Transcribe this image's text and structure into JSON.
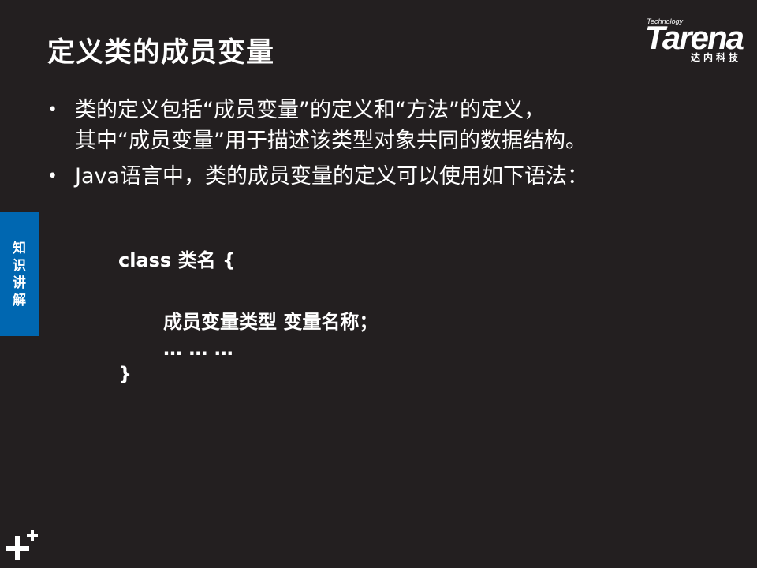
{
  "slide": {
    "title": "定义类的成员变量",
    "bullets": [
      {
        "lines": [
          "类的定义包括“成员变量”的定义和“方法”的定义，",
          "其中“成员变量”用于描述该类型对象共同的数据结构。"
        ]
      },
      {
        "lines": [
          "Java语言中，类的成员变量的定义可以使用如下语法："
        ]
      }
    ],
    "code": {
      "line1": "class 类名 {",
      "line2": "成员变量类型 变量名称；",
      "line3": "… … …",
      "line4": "}"
    }
  },
  "logo": {
    "brand": "Tarena",
    "tagline": "Technology",
    "chinese": "达内科技"
  },
  "side_tab": {
    "chars": [
      "知",
      "识",
      "讲",
      "解"
    ]
  },
  "bullet_symbol": "•"
}
